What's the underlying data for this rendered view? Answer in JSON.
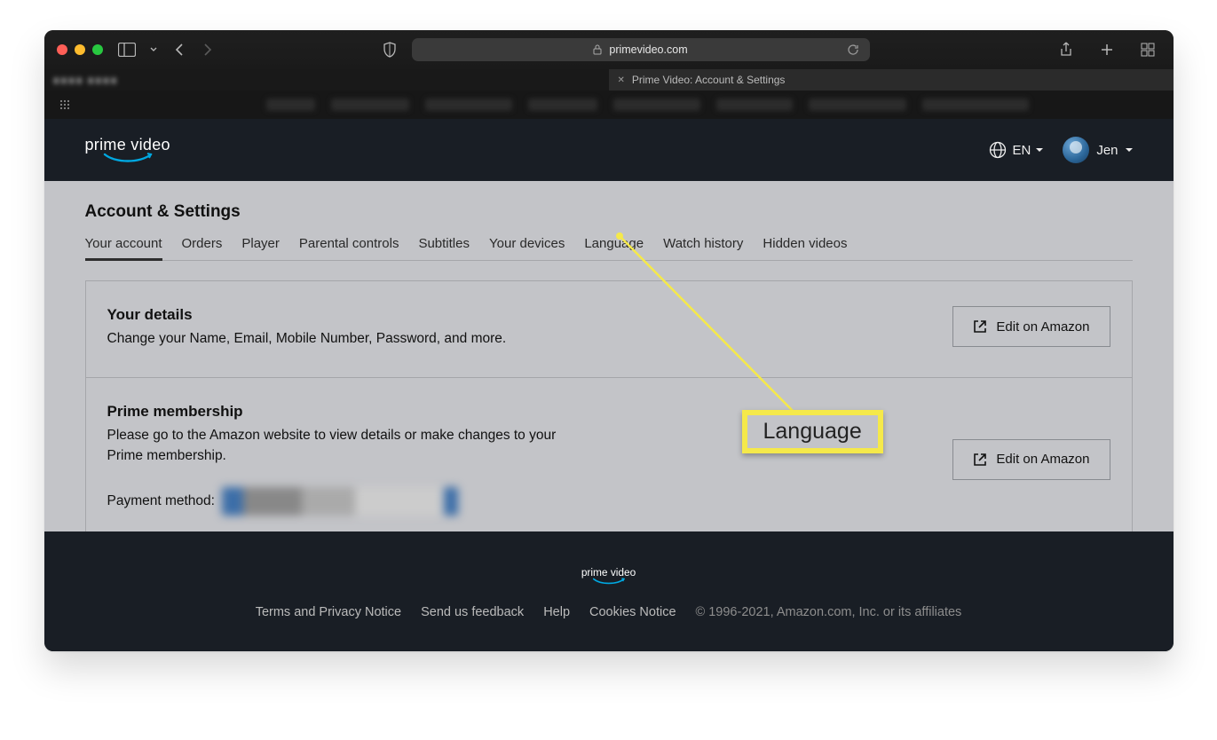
{
  "browser": {
    "url": "primevideo.com",
    "tab1_label": "",
    "tab2_label": "Prime Video: Account & Settings"
  },
  "header": {
    "logo_top": "prime video",
    "lang_code": "EN",
    "username": "Jen"
  },
  "page": {
    "title": "Account & Settings",
    "tabs": [
      {
        "label": "Your account",
        "active": true
      },
      {
        "label": "Orders"
      },
      {
        "label": "Player"
      },
      {
        "label": "Parental controls"
      },
      {
        "label": "Subtitles"
      },
      {
        "label": "Your devices"
      },
      {
        "label": "Language"
      },
      {
        "label": "Watch history"
      },
      {
        "label": "Hidden videos"
      }
    ],
    "cards": {
      "details": {
        "title": "Your details",
        "desc": "Change your Name, Email, Mobile Number, Password, and more.",
        "cta": "Edit on Amazon"
      },
      "prime": {
        "title": "Prime membership",
        "desc": "Please go to the Amazon website to view details or make changes to your Prime membership.",
        "payment_label": "Payment method:",
        "cta": "Edit on Amazon"
      }
    }
  },
  "callout": {
    "label": "Language"
  },
  "footer": {
    "links": [
      "Terms and Privacy Notice",
      "Send us feedback",
      "Help",
      "Cookies Notice"
    ],
    "copyright": "© 1996-2021, Amazon.com, Inc. or its affiliates"
  }
}
